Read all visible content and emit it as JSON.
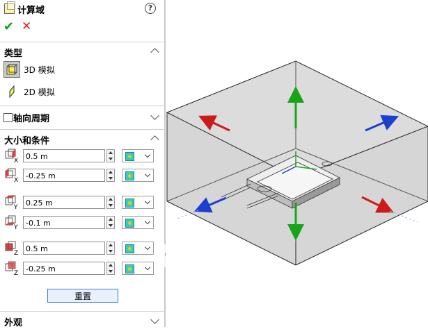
{
  "title": "计算域",
  "help": "?",
  "ok_icon": "checkmark-icon",
  "cancel_icon": "x-icon",
  "sections": {
    "type": {
      "header": "类型",
      "options": [
        {
          "label": "3D 模拟",
          "selected": true
        },
        {
          "label": "2D 模拟",
          "selected": false
        }
      ]
    },
    "axial": {
      "header": "轴向周期",
      "checked": false
    },
    "size": {
      "header": "大小和条件"
    },
    "appearance": {
      "header": "外观"
    }
  },
  "fields": [
    {
      "axis": "X",
      "value": "0.5 m"
    },
    {
      "axis": "X",
      "value": "-0.25 m"
    },
    {
      "axis": "Y",
      "value": "0.25 m"
    },
    {
      "axis": "Y",
      "value": "-0.1 m"
    },
    {
      "axis": "Z",
      "value": "0.5 m"
    },
    {
      "axis": "Z",
      "value": "-0.25 m"
    }
  ],
  "reset_label": "重置",
  "colors": {
    "accent": "#3a7bd5",
    "ok": "#1a9c1a",
    "cancel": "#e02020",
    "arrow_red": "#cc1a1a",
    "arrow_green": "#19a319",
    "arrow_blue": "#1d3fcf"
  }
}
